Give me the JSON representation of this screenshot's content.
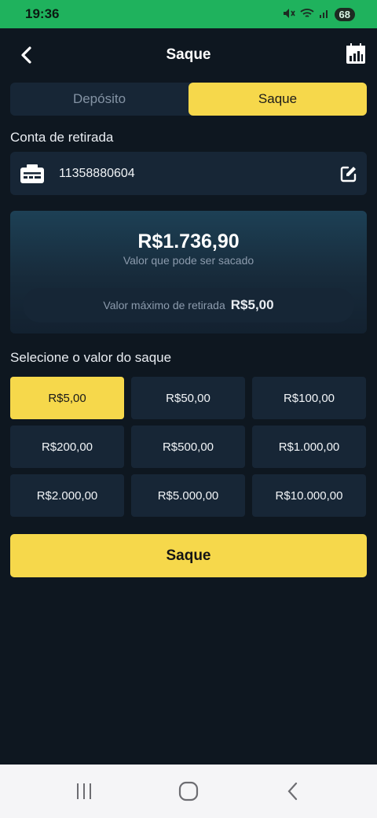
{
  "status_bar": {
    "time": "19:36",
    "battery": "68"
  },
  "header": {
    "title": "Saque"
  },
  "tabs": [
    {
      "label": "Depósito",
      "active": false
    },
    {
      "label": "Saque",
      "active": true
    }
  ],
  "account": {
    "section_label": "Conta de retirada",
    "number": "11358880604"
  },
  "balance": {
    "amount": "R$1.736,90",
    "caption": "Valor que pode ser sacado",
    "max_label": "Valor máximo de retirada",
    "max_value": "R$5,00"
  },
  "amounts": {
    "section_label": "Selecione o valor do saque",
    "options": [
      {
        "label": "R$5,00",
        "selected": true
      },
      {
        "label": "R$50,00",
        "selected": false
      },
      {
        "label": "R$100,00",
        "selected": false
      },
      {
        "label": "R$200,00",
        "selected": false
      },
      {
        "label": "R$500,00",
        "selected": false
      },
      {
        "label": "R$1.000,00",
        "selected": false
      },
      {
        "label": "R$2.000,00",
        "selected": false
      },
      {
        "label": "R$5.000,00",
        "selected": false
      },
      {
        "label": "R$10.000,00",
        "selected": false
      }
    ]
  },
  "submit": {
    "label": "Saque"
  },
  "colors": {
    "accent": "#f6d84b",
    "background": "#0e1720",
    "panel": "#172636",
    "status_bar": "#1fb25d"
  },
  "icons": {
    "back": "chevron-left-icon",
    "calendar": "calendar-icon",
    "card": "id-card-icon",
    "edit": "edit-icon"
  }
}
